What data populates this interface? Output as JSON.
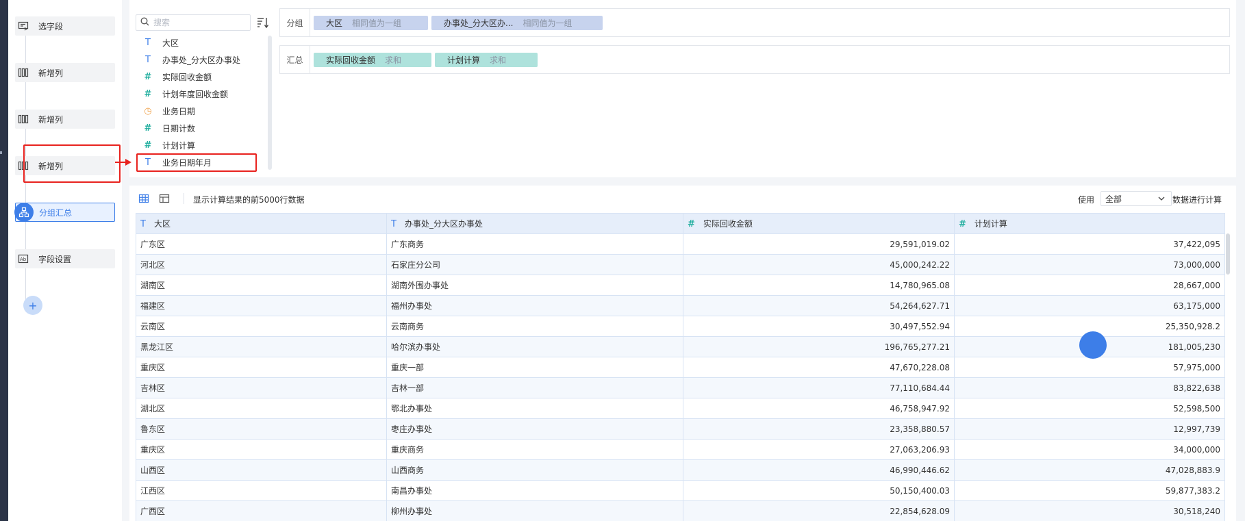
{
  "steps": [
    {
      "label": "选字段",
      "icon": "select-field-icon"
    },
    {
      "label": "新增列",
      "icon": "add-column-icon"
    },
    {
      "label": "新增列",
      "icon": "add-column-icon"
    },
    {
      "label": "新增列",
      "icon": "add-column-icon"
    },
    {
      "label": "分组汇总",
      "icon": "group-summary-icon"
    },
    {
      "label": "字段设置",
      "icon": "field-settings-icon"
    }
  ],
  "add_step_label": "+",
  "search": {
    "placeholder": "搜索"
  },
  "fields": [
    {
      "type": "T",
      "label": "大区"
    },
    {
      "type": "T",
      "label": "办事处_分大区办事处"
    },
    {
      "type": "#",
      "label": "实际回收金额"
    },
    {
      "type": "#",
      "label": "计划年度回收金额"
    },
    {
      "type": "◷",
      "label": "业务日期"
    },
    {
      "type": "#",
      "label": "日期计数"
    },
    {
      "type": "#",
      "label": "计划计算"
    },
    {
      "type": "T",
      "label": "业务日期年月"
    }
  ],
  "group_zone": {
    "label": "分组",
    "chips": [
      {
        "name": "大区",
        "agg": "相同值为一组"
      },
      {
        "name": "办事处_分大区办...",
        "agg": "相同值为一组"
      }
    ]
  },
  "summary_zone": {
    "label": "汇总",
    "chips": [
      {
        "name": "实际回收金额",
        "agg": "求和"
      },
      {
        "name": "计划计算",
        "agg": "求和"
      }
    ]
  },
  "toolbar": {
    "note": "显示计算结果的前5000行数据",
    "use_label": "使用",
    "use_value": "全部",
    "use_suffix": "数据进行计算"
  },
  "table": {
    "columns": [
      {
        "type": "T",
        "label": "大区"
      },
      {
        "type": "T",
        "label": "办事处_分大区办事处"
      },
      {
        "type": "#",
        "label": "实际回收金额"
      },
      {
        "type": "#",
        "label": "计划计算"
      }
    ],
    "rows": [
      [
        "广东区",
        "广东商务",
        "29,591,019.02",
        "37,422,095"
      ],
      [
        "河北区",
        "石家庄分公司",
        "45,000,242.22",
        "73,000,000"
      ],
      [
        "湖南区",
        "湖南外围办事处",
        "14,780,965.08",
        "28,667,000"
      ],
      [
        "福建区",
        "福州办事处",
        "54,264,627.71",
        "63,175,000"
      ],
      [
        "云南区",
        "云南商务",
        "30,497,552.94",
        "25,350,928.2"
      ],
      [
        "黑龙江区",
        "哈尔滨办事处",
        "196,765,277.21",
        "181,005,230"
      ],
      [
        "重庆区",
        "重庆一部",
        "47,670,228.08",
        "57,975,000"
      ],
      [
        "吉林区",
        "吉林一部",
        "77,110,684.44",
        "83,822,638"
      ],
      [
        "湖北区",
        "鄂北办事处",
        "46,758,947.92",
        "52,598,500"
      ],
      [
        "鲁东区",
        "枣庄办事处",
        "23,358,880.57",
        "12,997,739"
      ],
      [
        "重庆区",
        "重庆商务",
        "27,063,206.93",
        "34,000,000"
      ],
      [
        "山西区",
        "山西商务",
        "46,990,446.62",
        "47,028,883.9"
      ],
      [
        "江西区",
        "南昌办事处",
        "50,150,400.03",
        "59,877,383.2"
      ],
      [
        "广西区",
        "柳州办事处",
        "22,854,628.09",
        "30,518,240"
      ]
    ]
  },
  "colors": {
    "accent": "#3d7ee8",
    "highlight_red": "#e8221e",
    "group_chip": "#c7d3ee",
    "sum_chip": "#aee2dc",
    "numeric_type": "#1fae9e",
    "date_type": "#f0a14a"
  }
}
